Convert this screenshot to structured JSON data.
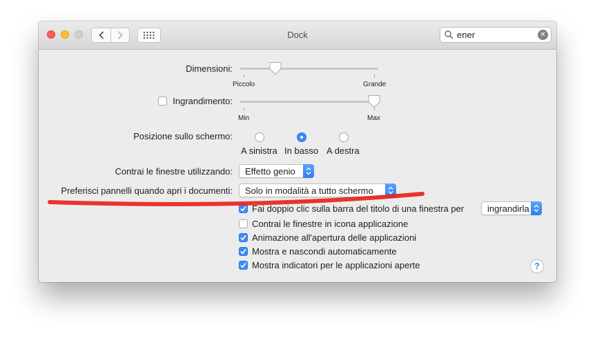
{
  "window": {
    "title": "Dock"
  },
  "search": {
    "value": "ener"
  },
  "size": {
    "label": "Dimensioni:",
    "min_label": "Piccolo",
    "max_label": "Grande",
    "value": 0.24
  },
  "magnification": {
    "label": "Ingrandimento:",
    "checked": false,
    "min_label": "Min",
    "max_label": "Max",
    "value": 1.0
  },
  "position": {
    "label": "Posizione sullo schermo:",
    "options": [
      "A sinistra",
      "In basso",
      "A destra"
    ],
    "selected": "In basso"
  },
  "minimize_effect": {
    "label": "Contrai le finestre utilizzando:",
    "value": "Effetto genio"
  },
  "prefer_tabs": {
    "label": "Preferisci pannelli quando apri i documenti:",
    "value": "Solo in modalità a tutto schermo"
  },
  "double_click": {
    "label": "Fai doppio clic sulla barra del titolo di una finestra per",
    "checked": true,
    "value": "ingrandirla"
  },
  "checkboxes": [
    {
      "label": "Contrai le finestre in icona applicazione",
      "checked": false
    },
    {
      "label": "Animazione all'apertura delle applicazioni",
      "checked": true
    },
    {
      "label": "Mostra e nascondi automaticamente",
      "checked": true
    },
    {
      "label": "Mostra indicatori per le applicazioni aperte",
      "checked": true
    }
  ],
  "help": {
    "label": "?"
  },
  "colors": {
    "accent": "#3c8cf7",
    "annotation": "#e8231e"
  }
}
